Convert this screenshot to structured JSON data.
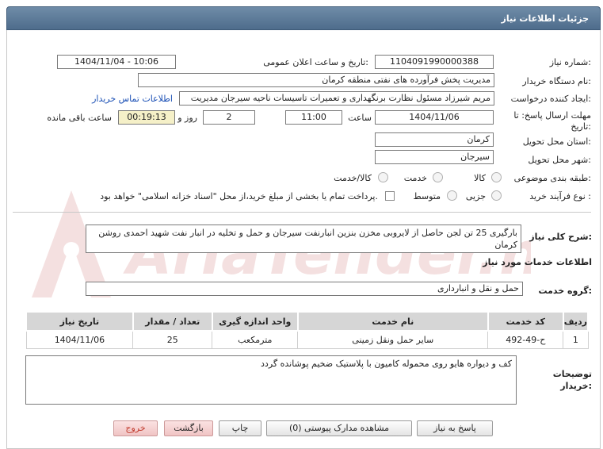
{
  "header": {
    "title": "جزئیات اطلاعات نیاز"
  },
  "fields": {
    "need_number_label": "شماره نیاز:",
    "need_number": "1104091990000388",
    "announce_label": "تاریخ و ساعت اعلان عمومی:",
    "announce_value": "1404/11/04 - 10:06",
    "buyer_org_label": "نام دستگاه خریدار:",
    "buyer_org": "مدیریت پخش فرآورده های نفتی منطقه کرمان",
    "creator_label": "ایجاد کننده درخواست:",
    "creator": "مریم  شیرزاد  مسئول نظارت برنگهداری و تعمیرات تاسیسات ناحیه سیرجان  مدیریت",
    "buyer_contact_link": "اطلاعات تماس خریدار",
    "deadline_label": "مهلت ارسال پاسخ: تا تاریخ:",
    "deadline_date": "1404/11/06",
    "time_label": "ساعت",
    "deadline_time": "11:00",
    "days_value": "2",
    "days_label": "روز و",
    "remaining_time": "00:19:13",
    "remaining_label": "ساعت باقی مانده",
    "province_label": "استان محل تحویل:",
    "province": "کرمان",
    "city_label": "شهر محل تحویل:",
    "city": "سیرجان",
    "category_label": "طبقه بندی موضوعی:",
    "category_options": [
      "کالا",
      "خدمت",
      "کالا/خدمت"
    ],
    "process_label": "نوع فرآیند خرید :",
    "process_options": [
      "جزیی",
      "متوسط"
    ],
    "payment_note": "پرداخت تمام یا بخشی از مبلغ خرید،از محل \"اسناد خزانه اسلامی\" خواهد بود."
  },
  "description": {
    "label": "شرح کلی نیاز:",
    "text": "بارگیری 25 تن لجن حاصل از لایروبی مخزن بنزین انبارنفت سیرجان و حمل و تخلیه در انبار نفت شهید احمدی روشن کرمان"
  },
  "services": {
    "section_title": "اطلاعات خدمات مورد نیاز",
    "group_label": "گروه خدمت:",
    "group_value": "حمل و نقل و انبارداری",
    "columns": [
      "ردیف",
      "کد خدمت",
      "نام خدمت",
      "واحد اندازه گیری",
      "تعداد / مقدار",
      "تاریخ نیاز"
    ],
    "rows": [
      [
        "1",
        "ح-49-492",
        "سایر حمل ونقل زمینی",
        "مترمکعب",
        "25",
        "1404/11/06"
      ]
    ]
  },
  "buyer_notes": {
    "label": "توضیحات خریدار:",
    "text": "کف و دیواره هایو روی محموله  کامیون با پلاستیک ضخیم پوشانده گردد"
  },
  "buttons": {
    "reply": "پاسخ به نیاز",
    "view_docs": "مشاهده مدارک پیوستی (0)",
    "print": "چاپ",
    "back": "بازگشت",
    "exit": "خروج"
  },
  "watermark": {
    "text": "AriaTender.net"
  },
  "colors": {
    "header": "#5a7898",
    "link": "#1a4fb5",
    "yellow_box": "#f5f0c8",
    "exit_text": "#c0392b"
  }
}
